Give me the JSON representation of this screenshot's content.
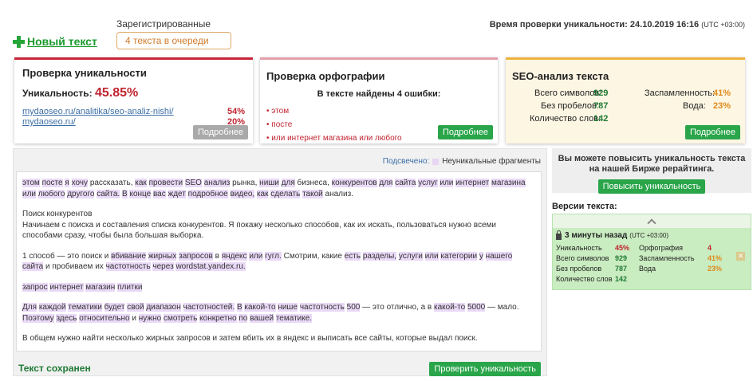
{
  "header": {
    "new_text": "Новый текст",
    "registered_label": "Зарегистрированные",
    "queue": "4 текста в очереди",
    "check_time_label": "Время проверки уникальности:",
    "check_time_value": "24.10.2019 16:16",
    "check_time_tz": "(UTC +03:00)"
  },
  "uniq_card": {
    "title": "Проверка уникальности",
    "uniq_label": "Уникальность:",
    "uniq_value": "45.85%",
    "links": [
      {
        "url": "mydaoseo.ru/analitika/seo-analiz-nishi/",
        "value": "54%"
      },
      {
        "url": "mydaoseo.ru/",
        "value": "20%"
      }
    ],
    "more": "Подробнее"
  },
  "spell_card": {
    "title": "Проверка орфографии",
    "found": "В тексте найдены 4 ошибки:",
    "errors": [
      "этом",
      "посте",
      "или интернет магазина или любого"
    ],
    "more": "Подробнее"
  },
  "seo_card": {
    "title": "SEO-анализ текста",
    "total_chars_label": "Всего символов:",
    "total_chars": "929",
    "no_spaces_label": "Без пробелов:",
    "no_spaces": "787",
    "words_label": "Количество слов:",
    "words": "142",
    "spam_label": "Заспамленность:",
    "spam": "41%",
    "water_label": "Вода:",
    "water": "23%",
    "more": "Подробнее"
  },
  "editor": {
    "highlight_label": "Подсвечено:",
    "highlight_legend": "Неуникальные фрагменты",
    "paragraphs": [
      "этом посте я хочу рассказать, как провести SEO анализ рынка, ниши для бизнеса, конкурентов для сайта услуг или интернет магазина или любого другого сайта. В конце вас ждет подробное видео, как сделать такой анализ.",
      "Поиск конкурентов\nНачинаем с поиска и составления списка конкурентов. Я покажу несколько способов, как их искать, пользоваться нужно всеми способами сразу, чтобы была большая выборка.",
      "1 способ — это поиск и вбивание жирных запросов в яндекс или гугл. Смотрим, какие есть разделы, услуги или категории у нашего сайта и пробиваем их частотность через wordstat.yandex.ru.",
      "запрос интернет магазин плитки",
      "Для каждой тематики будет свой диапазон частотностей. В какой-то нише частотность 500 — это отлично, а в какой-то 5000 — мало. Поэтому здесь относительно и нужно смотреть конкретно по вашей тематике.",
      "В общем нужно найти несколько жирных запросов и затем вбить их в яндекс и выписать все сайты, которые выдал поиск."
    ],
    "saved": "Текст сохранен",
    "check_button": "Проверить уникальность"
  },
  "sidebar": {
    "promo": "Вы можете повысить уникальность текста на нашей Бирже рерайтинга.",
    "promo_button": "Повысить уникальность",
    "versions_title": "Версии текста:",
    "version": {
      "time": "3 минуты назад",
      "tz": "(UTC +03:00)",
      "uniq_label": "Уникальность",
      "uniq": "45%",
      "chars_label": "Всего символов",
      "chars": "929",
      "no_spaces_label": "Без пробелов",
      "no_spaces": "787",
      "words_label": "Количество слов",
      "words": "142",
      "spell_label": "Орфография",
      "spell": "4",
      "spam_label": "Заспамленность",
      "spam": "41%",
      "water_label": "Вода",
      "water": "23%"
    }
  },
  "colors": {
    "accent_green": "#2aa54a",
    "uniq_red": "#c0242f",
    "seo_orange": "#efb13c",
    "highlight": "#ead9f7"
  }
}
